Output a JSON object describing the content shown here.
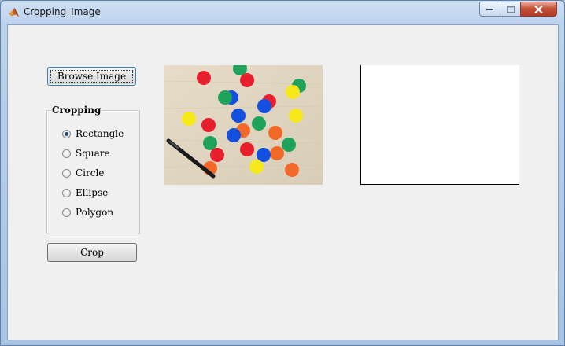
{
  "window": {
    "title": "Cropping_Image",
    "controls": {
      "minimize": "minimize-icon",
      "maximize": "maximize-icon",
      "close": "close-icon"
    }
  },
  "buttons": {
    "browse_label": "Browse Image",
    "crop_label": "Crop"
  },
  "cropping_group": {
    "legend": "Cropping",
    "options": [
      {
        "label": "Rectangle",
        "checked": true
      },
      {
        "label": "Square",
        "checked": false
      },
      {
        "label": "Circle",
        "checked": false
      },
      {
        "label": "Ellipse",
        "checked": false
      },
      {
        "label": "Polygon",
        "checked": false
      }
    ]
  },
  "preview": {
    "source_image": "colored-dots-photo",
    "cropped_output": "empty-white-axes"
  },
  "colors": {
    "window_border": "#5d7fa8",
    "client_bg": "#f0f0f0",
    "close_button": "#c5513a",
    "dot_red": "#e8202e",
    "dot_green": "#1fa25a",
    "dot_blue": "#1450e0",
    "dot_yellow": "#f7e81a",
    "dot_orange": "#f2692a",
    "wood": "#e2d8c4"
  }
}
